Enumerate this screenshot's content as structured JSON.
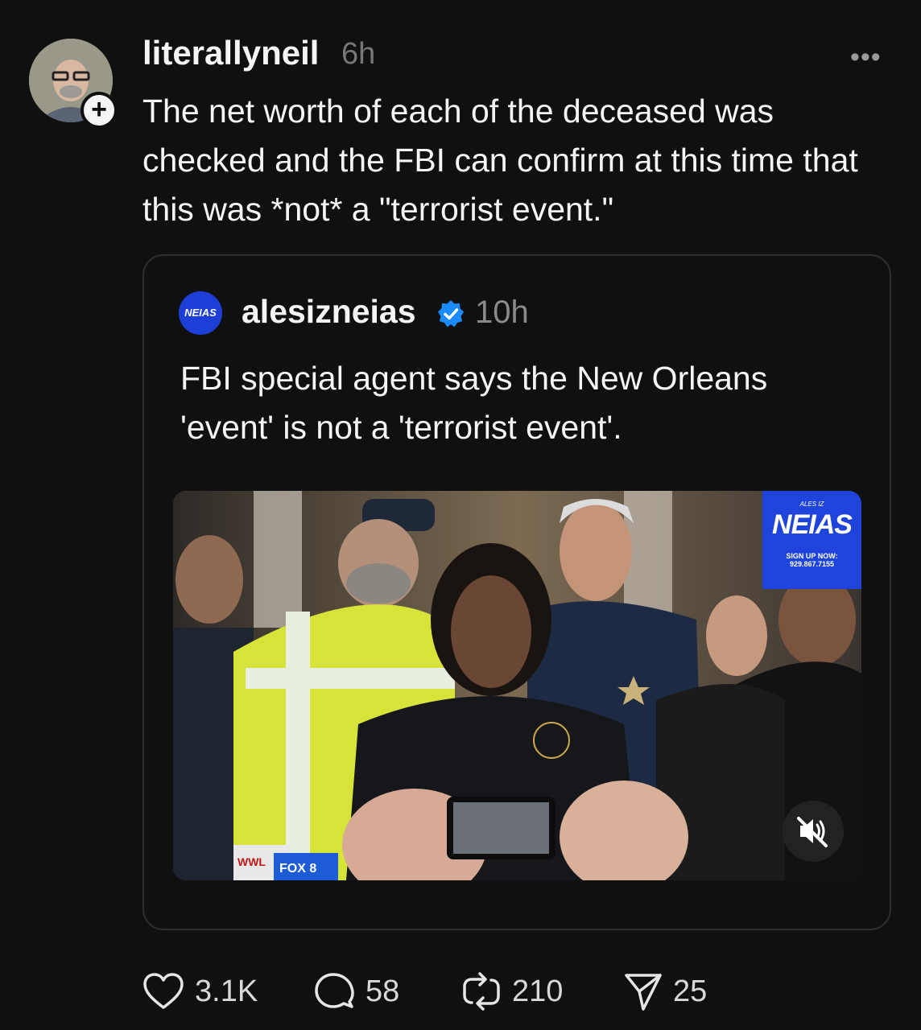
{
  "post": {
    "username": "literallyneil",
    "time": "6h",
    "more_label": "•••",
    "text": "The net worth of each of the deceased was checked and the FBI can confirm at this time that this was *not* a \"terrorist event.\"",
    "follow_label": "+"
  },
  "quote": {
    "avatar_text": "NEIAS",
    "username": "alesizneias",
    "time": "10h",
    "text": "FBI special agent says the New Orleans 'event' is not a 'terrorist event'."
  },
  "video": {
    "logo_small": "ALES IZ",
    "logo_name": "NEIAS",
    "logo_cta": "SIGN UP NOW:",
    "logo_phone": "929.867.7155",
    "mic_labels": [
      "WWL",
      "FOX 8"
    ]
  },
  "actions": {
    "likes": "3.1K",
    "replies": "58",
    "reposts": "210",
    "shares": "25"
  },
  "icons": [
    "heart-icon",
    "comment-icon",
    "repost-icon",
    "send-icon",
    "verified-icon",
    "mute-icon",
    "more-icon"
  ]
}
